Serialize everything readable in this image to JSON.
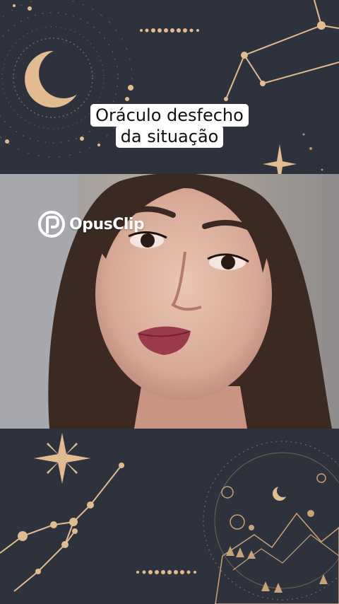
{
  "caption": {
    "line1": "Oráculo desfecho",
    "line2": "da situação"
  },
  "watermark": {
    "brand": "OpusClip",
    "icon": "opusclip-logo-icon"
  },
  "colors": {
    "panel_bg": "#2e323c",
    "gold": "#e3bb90",
    "caption_bg": "#ffffff",
    "caption_text": "#111111"
  },
  "decor_icons": [
    "crescent-moon-icon",
    "star-icon",
    "constellation-icon",
    "moon-phases-icon",
    "mountain-landscape-icon"
  ]
}
